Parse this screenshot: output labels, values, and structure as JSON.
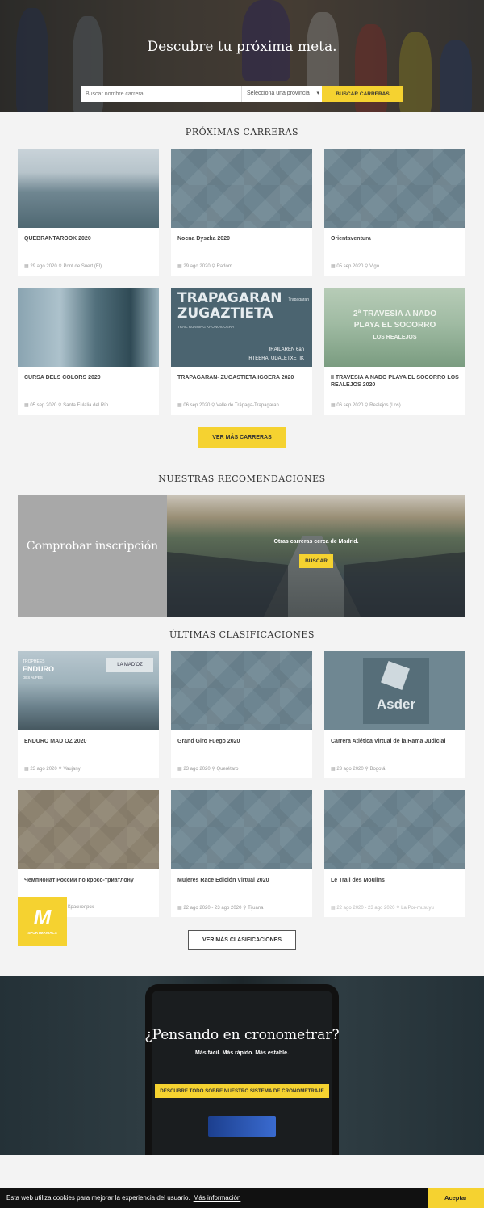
{
  "hero": {
    "title": "Descubre tu próxima meta.",
    "search_placeholder": "Buscar nombre carrera",
    "province_select": "Selecciona una provincia",
    "search_button": "BUSCAR CARRERAS"
  },
  "upcoming": {
    "title": "PRÓXIMAS CARRERAS",
    "cards": [
      {
        "name": "QUEBRANTAROOK 2020",
        "date": "29 ago 2020",
        "place": "Pont de Suert (El)"
      },
      {
        "name": "Nocna Dyszka 2020",
        "date": "29 ago 2020",
        "place": "Radom"
      },
      {
        "name": "Orientaventura",
        "date": "05 sep 2020",
        "place": "Vigo"
      },
      {
        "name": "CURSA DELS COLORS 2020",
        "date": "05 sep 2020",
        "place": "Santa Eulalia del Río"
      },
      {
        "name": "TRAPAGARAN- ZUGASTIETA IGOERA 2020",
        "date": "06 sep 2020",
        "place": "Valle de Trápaga-Trapagaran"
      },
      {
        "name": "II TRAVESIA A NADO PLAYA EL SOCORRO LOS REALEJOS 2020",
        "date": "06 sep 2020",
        "place": "Realejos (Los)"
      }
    ],
    "more_button": "VER MÁS CARRERAS"
  },
  "recommendations": {
    "title": "NUESTRAS RECOMENDACIONES",
    "check_label": "Comprobar inscripción",
    "nearby_text": "Otras carreras cerca de Madrid.",
    "nearby_button": "BUSCAR"
  },
  "results": {
    "title": "ÚLTIMAS CLASIFICACIONES",
    "cards": [
      {
        "name": "ENDURO MAD OZ 2020",
        "date": "23 ago 2020",
        "place": "Vaujany"
      },
      {
        "name": "Grand Giro Fuego 2020",
        "date": "23 ago 2020",
        "place": "Querétaro"
      },
      {
        "name": "Carrera Atlética Virtual de la Rama Judicial",
        "date": "23 ago 2020",
        "place": "Bogotá"
      },
      {
        "name": "Чемпионат России по кросс-триатлону",
        "date": "",
        "place": "Красноярск"
      },
      {
        "name": "Mujeres Race Edición Virtual 2020",
        "date": "22 ago 2020 - 23 ago 2020",
        "place": "Tijuana"
      },
      {
        "name": "Le Trail des Moulins",
        "date": "22 ago 2020 - 23 ago 2020",
        "place": "La Por-musuyu"
      }
    ],
    "more_button": "VER MÁS CLASIFICACIONES"
  },
  "image_text": {
    "trap_line1": "TRAPAGARAN",
    "trap_line2": "ZUGAZTIETA",
    "trap_sub": "TRAIL RUNNING KRONOIGOERA",
    "trap_brand": "Trapagaran",
    "trap_line3": "IRAILAREN 6an",
    "trap_line4": "IRTEERA: UDALETXETIK",
    "trav_line1": "2ª TRAVESÍA A NADO",
    "trav_line2": "PLAYA EL SOCORRO",
    "trav_line3": "LOS REALEJOS",
    "enduro_l1": "TROPHÉES",
    "enduro_l2": "ENDURO",
    "enduro_l3": "DES ALPES",
    "enduro_sign": "LA MAD'OZ",
    "asder": "Asder"
  },
  "logo": {
    "mark": "M",
    "text": "SPORTMANIACS"
  },
  "crono": {
    "title": "¿Pensando en cronometrar?",
    "subtitle": "Más fácil. Más rápido. Más estable.",
    "button": "DESCUBRE TODO SOBRE NUESTRO SISTEMA DE CRONOMETRAJE"
  },
  "cookie": {
    "text": "Esta web utiliza cookies para mejorar la experiencia del usuario.",
    "more": "Más información",
    "accept": "Aceptar"
  },
  "colors": {
    "accent": "#f5d230",
    "placeholder_img": "#6d8591",
    "dark": "#111111"
  }
}
